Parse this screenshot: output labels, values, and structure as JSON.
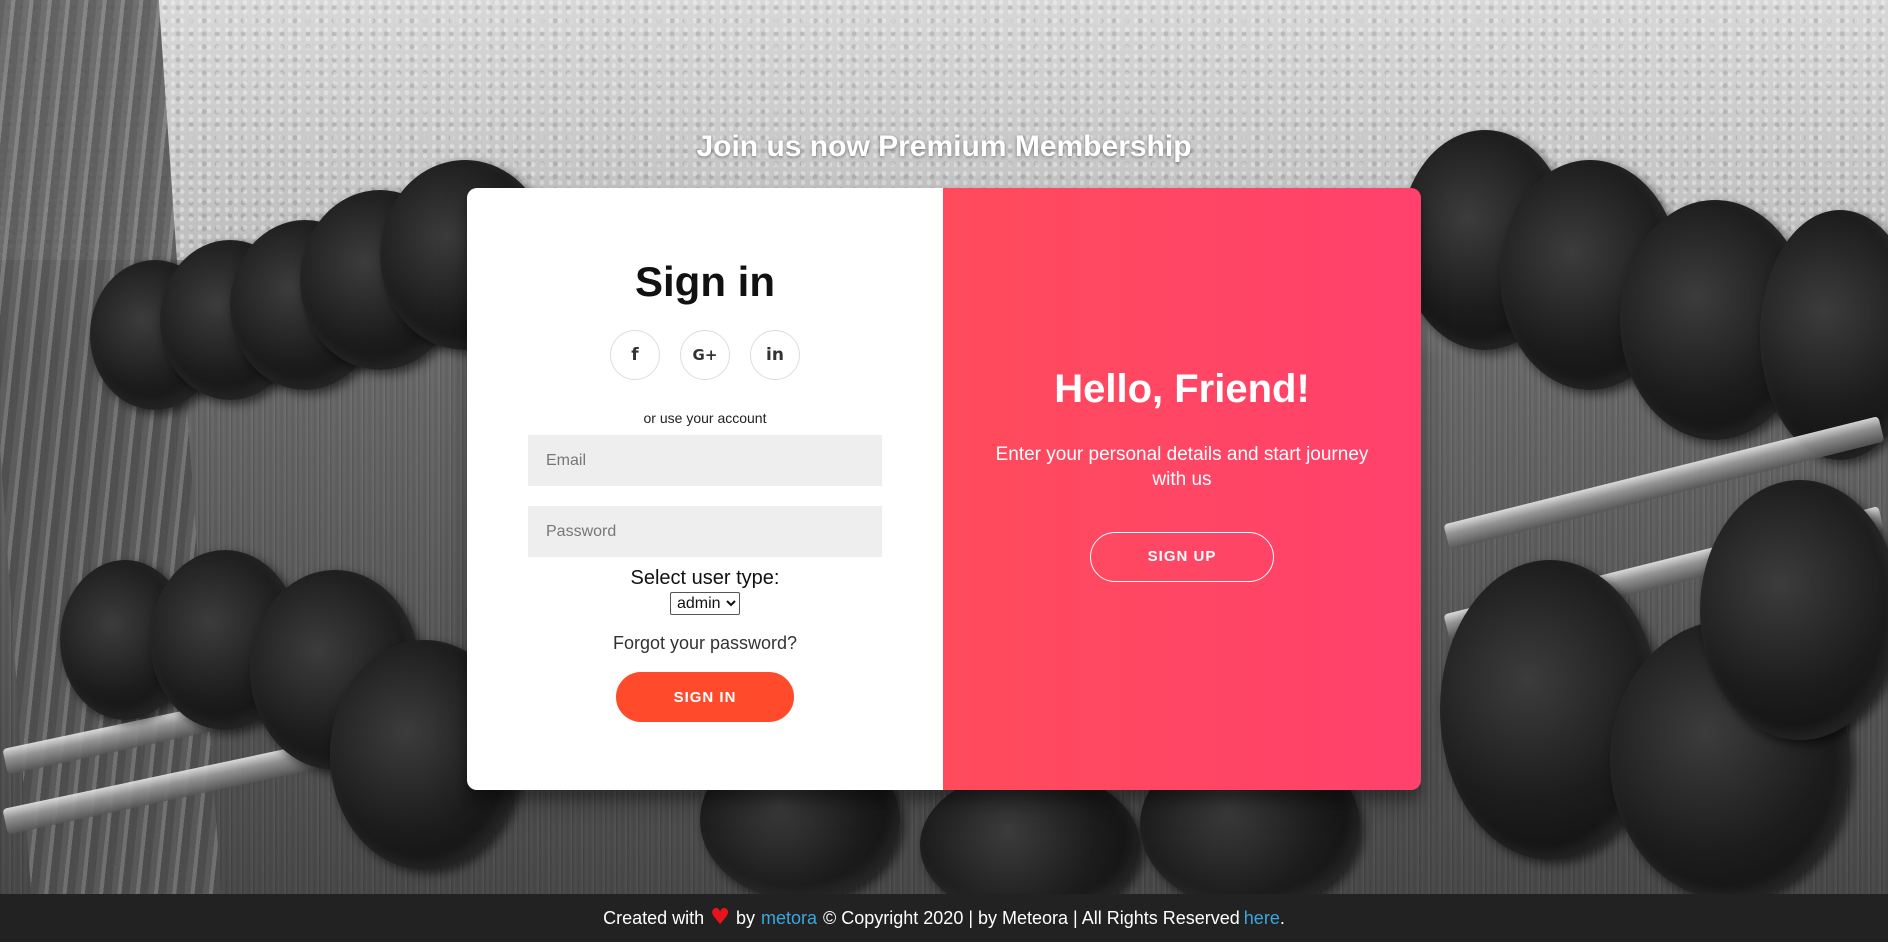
{
  "page": {
    "headline": "Join us now Premium Membership"
  },
  "signin": {
    "title": "Sign in",
    "social": [
      {
        "icon": "facebook-icon",
        "glyph": "f"
      },
      {
        "icon": "google-plus-icon",
        "glyph": "G+"
      },
      {
        "icon": "linkedin-icon",
        "glyph": "in"
      }
    ],
    "or_text": "or use your account",
    "email_placeholder": "Email",
    "password_placeholder": "Password",
    "usertype_label": "Select user type:",
    "usertype_selected": "admin",
    "forgot_text": "Forgot your password?",
    "button_label": "Sign In",
    "button_color": "#ff4b2b"
  },
  "overlay": {
    "title": "Hello, Friend!",
    "text": "Enter your personal details and start journey with us",
    "button_label": "Sign Up",
    "gradient": [
      "#ff4b5c",
      "#ff416c"
    ]
  },
  "footer": {
    "prefix": "Created with",
    "heart_icon": "heart-icon",
    "by1": "by",
    "link1": "metora",
    "copyright": "© Copyright 2020 | by Meteora | All Rights Reserved",
    "link2": "here",
    "suffix": "."
  }
}
